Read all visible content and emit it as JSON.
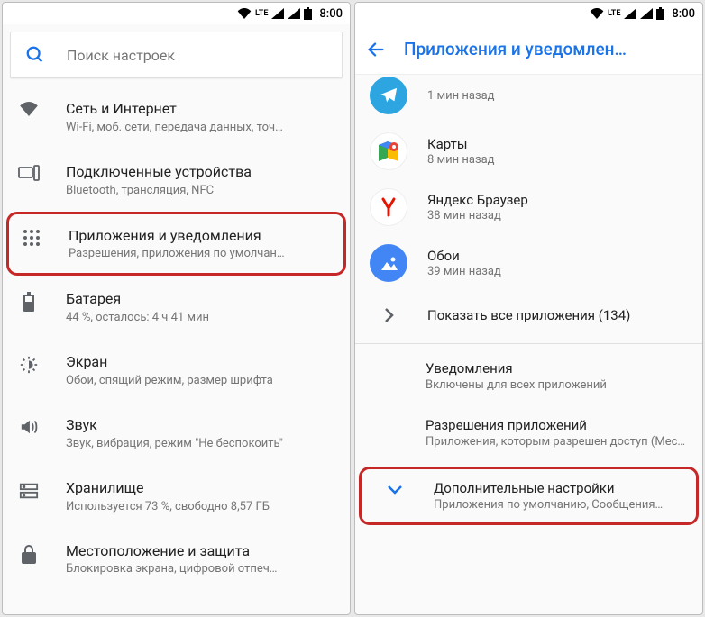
{
  "status": {
    "time": "8:00",
    "lte": "LTE"
  },
  "left": {
    "search_placeholder": "Поиск настроек",
    "items": [
      {
        "title": "Сеть и Интернет",
        "subtitle": "Wi-Fi, моб. сети, передача данных, точ…"
      },
      {
        "title": "Подключенные устройства",
        "subtitle": "Bluetooth, трансляция, NFC"
      },
      {
        "title": "Приложения и уведомления",
        "subtitle": "Разрешения, приложения по умолчан…"
      },
      {
        "title": "Батарея",
        "subtitle": "44 %, осталось: 4 ч 41 мин"
      },
      {
        "title": "Экран",
        "subtitle": "Обои, спящий режим, размер шрифта"
      },
      {
        "title": "Звук",
        "subtitle": "Звук, вибрация, режим \"Не беспокоить\""
      },
      {
        "title": "Хранилище",
        "subtitle": "Используется 73 %, свободно 8,57 ГБ"
      },
      {
        "title": "Местоположение и защита",
        "subtitle": "Блокировка экрана, цифровой отпеч…"
      }
    ]
  },
  "right": {
    "header": "Приложения и уведомлен…",
    "apps": [
      {
        "name_hidden": "",
        "subtitle": "1 мин назад"
      },
      {
        "name": "Карты",
        "subtitle": "8 мин назад"
      },
      {
        "name": "Яндекс Браузер",
        "subtitle": "38 мин назад"
      },
      {
        "name": "Обои",
        "subtitle": "39 мин назад"
      }
    ],
    "show_all": "Показать все приложения (134)",
    "sections": [
      {
        "title": "Уведомления",
        "subtitle": "Включены для всех приложений"
      },
      {
        "title": "Разрешения приложений",
        "subtitle": "Приложения, которым разрешен доступ (Местоположение, Микрофон, Камера)"
      }
    ],
    "expand": {
      "title": "Дополнительные настройки",
      "subtitle": "Приложения по умолчанию, Сообщения…"
    }
  }
}
